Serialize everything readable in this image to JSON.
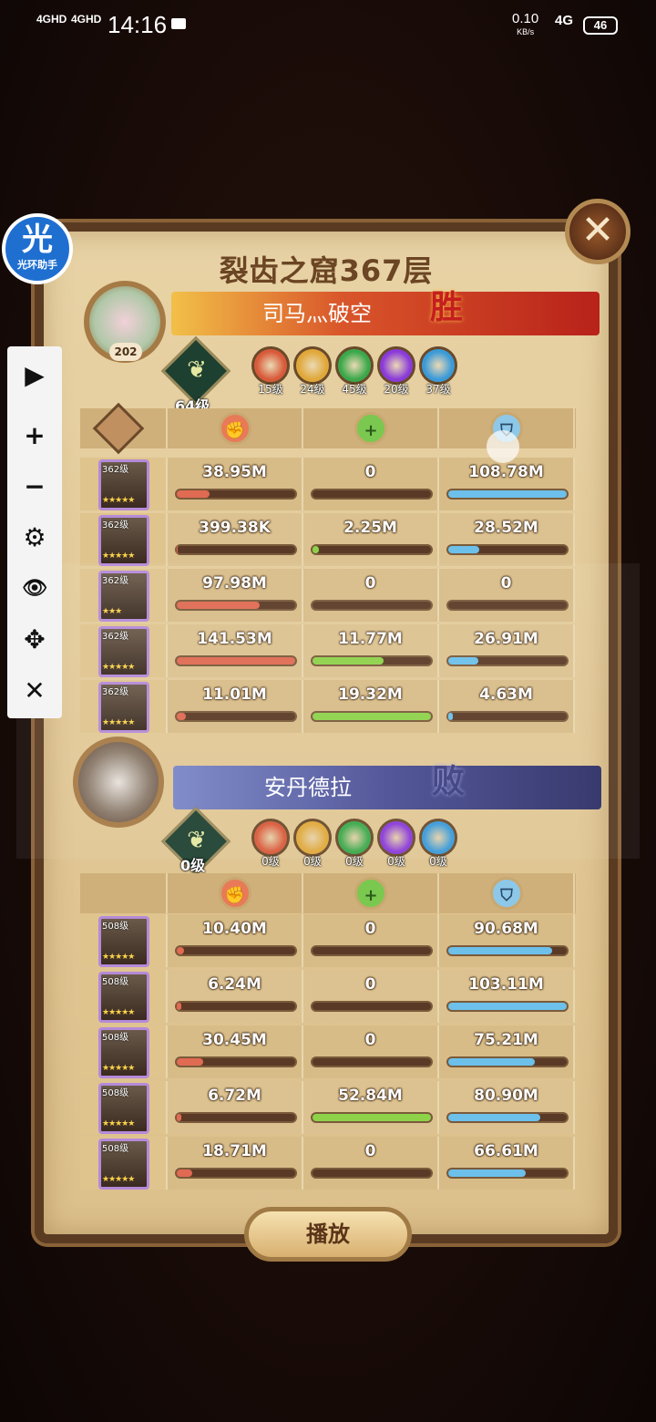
{
  "status_bar": {
    "net1": "4GHD",
    "net2": "4GHD",
    "time": "14:16",
    "speed": "0.10",
    "speed_unit": "KB/s",
    "net3": "4G",
    "battery": "46"
  },
  "helper_logo": {
    "char": "光",
    "label": "光环助手"
  },
  "panel": {
    "title": "裂齿之窟367层",
    "close": "✕"
  },
  "team1": {
    "player_level": "202",
    "name": "司马灬破空",
    "result": "胜",
    "emblem_level": "64级",
    "factions": [
      {
        "level": "15级",
        "color": "#d85a3a"
      },
      {
        "level": "24级",
        "color": "#e0a83a"
      },
      {
        "level": "45级",
        "color": "#3aa84a"
      },
      {
        "level": "20级",
        "color": "#8a3ad8"
      },
      {
        "level": "37级",
        "color": "#3a9ad8"
      }
    ],
    "heroes": [
      {
        "level": "362级",
        "stars": "★★★★★",
        "dmg": "38.95M",
        "heal": "0",
        "shield": "108.78M",
        "dmg_pct": 0.28,
        "heal_pct": 0,
        "shield_pct": 1.0
      },
      {
        "level": "362级",
        "stars": "★★★★★",
        "dmg": "399.38K",
        "heal": "2.25M",
        "shield": "28.52M",
        "dmg_pct": 0.01,
        "heal_pct": 0.05,
        "shield_pct": 0.26
      },
      {
        "level": "362级",
        "stars": "★★★",
        "dmg": "97.98M",
        "heal": "0",
        "shield": "0",
        "dmg_pct": 0.7,
        "heal_pct": 0,
        "shield_pct": 0
      },
      {
        "level": "362级",
        "stars": "★★★★★",
        "dmg": "141.53M",
        "heal": "11.77M",
        "shield": "26.91M",
        "dmg_pct": 1.0,
        "heal_pct": 0.6,
        "shield_pct": 0.25
      },
      {
        "level": "362级",
        "stars": "★★★★★",
        "dmg": "11.01M",
        "heal": "19.32M",
        "shield": "4.63M",
        "dmg_pct": 0.08,
        "heal_pct": 1.0,
        "shield_pct": 0.04
      }
    ]
  },
  "team2": {
    "name": "安丹德拉",
    "result": "败",
    "emblem_level": "0级",
    "factions": [
      {
        "level": "0级",
        "color": "#d85a3a"
      },
      {
        "level": "0级",
        "color": "#e0a83a"
      },
      {
        "level": "0级",
        "color": "#3aa84a"
      },
      {
        "level": "0级",
        "color": "#8a3ad8"
      },
      {
        "level": "0级",
        "color": "#3a9ad8"
      }
    ],
    "heroes": [
      {
        "level": "508级",
        "stars": "★★★★★",
        "dmg": "10.40M",
        "heal": "0",
        "shield": "90.68M",
        "dmg_pct": 0.06,
        "heal_pct": 0,
        "shield_pct": 0.88
      },
      {
        "level": "508级",
        "stars": "★★★★★",
        "dmg": "6.24M",
        "heal": "0",
        "shield": "103.11M",
        "dmg_pct": 0.04,
        "heal_pct": 0,
        "shield_pct": 1.0
      },
      {
        "level": "508级",
        "stars": "★★★★★",
        "dmg": "30.45M",
        "heal": "0",
        "shield": "75.21M",
        "dmg_pct": 0.22,
        "heal_pct": 0,
        "shield_pct": 0.73
      },
      {
        "level": "508级",
        "stars": "★★★★★",
        "dmg": "6.72M",
        "heal": "52.84M",
        "shield": "80.90M",
        "dmg_pct": 0.04,
        "heal_pct": 1.0,
        "shield_pct": 0.78
      },
      {
        "level": "508级",
        "stars": "★★★★★",
        "dmg": "18.71M",
        "heal": "0",
        "shield": "66.61M",
        "dmg_pct": 0.13,
        "heal_pct": 0,
        "shield_pct": 0.65
      }
    ]
  },
  "play_button": "播放",
  "floatbar": {
    "play": "▶",
    "zoom_in": "+",
    "zoom_out": "−",
    "settings": "⚙",
    "view": "👁",
    "move": "✥",
    "close": "✕"
  }
}
